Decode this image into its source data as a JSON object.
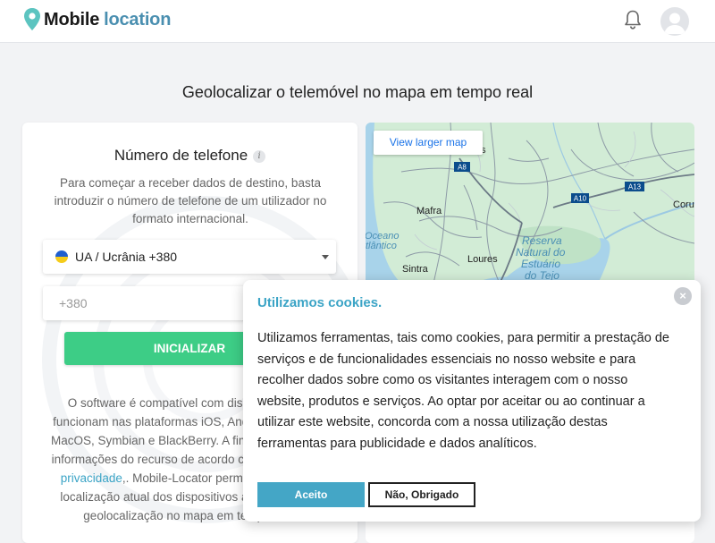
{
  "header": {
    "brand_primary": "Mobile",
    "brand_secondary": "location",
    "icons": {
      "logo": "map-pin-icon",
      "notifications": "bell-icon",
      "account": "user-avatar-icon"
    }
  },
  "headline": "Geolocalizar o telemóvel no mapa em tempo real",
  "phone_form": {
    "title": "Número de telefone",
    "info_icon": "i",
    "intro": "Para começar a receber dados de destino, basta introduzir o número de telefone de um utilizador no formato internacional.",
    "country_select": {
      "selected": "UA / Ucrânia +380",
      "flag": "ukraine-flag"
    },
    "phone_input": {
      "placeholder": "+380",
      "value": ""
    },
    "start_button": "INICIALIZAR",
    "description_before_link": "O software é compatível com dispositivos que funcionam nas plataformas iOS, Android, Windows, MacOS, Symbian e BlackBerry. A fim de proteger as informações do recurso de acordo com a política de ",
    "description_link": "privacidade",
    "description_after_link": ",. Mobile-Locator permite encontrar a localização atual dos dispositivos através da sua geolocalização no mapa em tempo real."
  },
  "map": {
    "view_larger_label": "View larger map",
    "labels": {
      "torres": "as",
      "mafra": "Mafra",
      "oceano_1": "Oceano",
      "oceano_2": "tlântico",
      "reserva_1": "Reserva",
      "reserva_2": "Natural do",
      "reserva_3": "Estuário",
      "reserva_4": "do Tejo",
      "sintra": "Sintra",
      "loures": "Loures",
      "coruche": "Coru",
      "a8": "A8",
      "a10": "A10",
      "a13": "A13"
    }
  },
  "cookie_dialog": {
    "title": "Utilizamos cookies.",
    "close_icon": "×",
    "text": "Utilizamos ferramentas, tais como cookies, para permitir a prestação de serviços e de funcionalidades essenciais no nosso website e para recolher dados sobre como os visitantes interagem com o nosso website, produtos e serviços. Ao optar por aceitar ou ao continuar a utilizar este website, concorda com a nossa utilização destas ferramentas para publicidade e dados analíticos.",
    "accept_label": "Aceito",
    "decline_label": "Não, Obrigado"
  },
  "colors": {
    "accent": "#3ba4c6",
    "start_button": "#3dcd86",
    "brand_blue": "#4a8fb0"
  }
}
